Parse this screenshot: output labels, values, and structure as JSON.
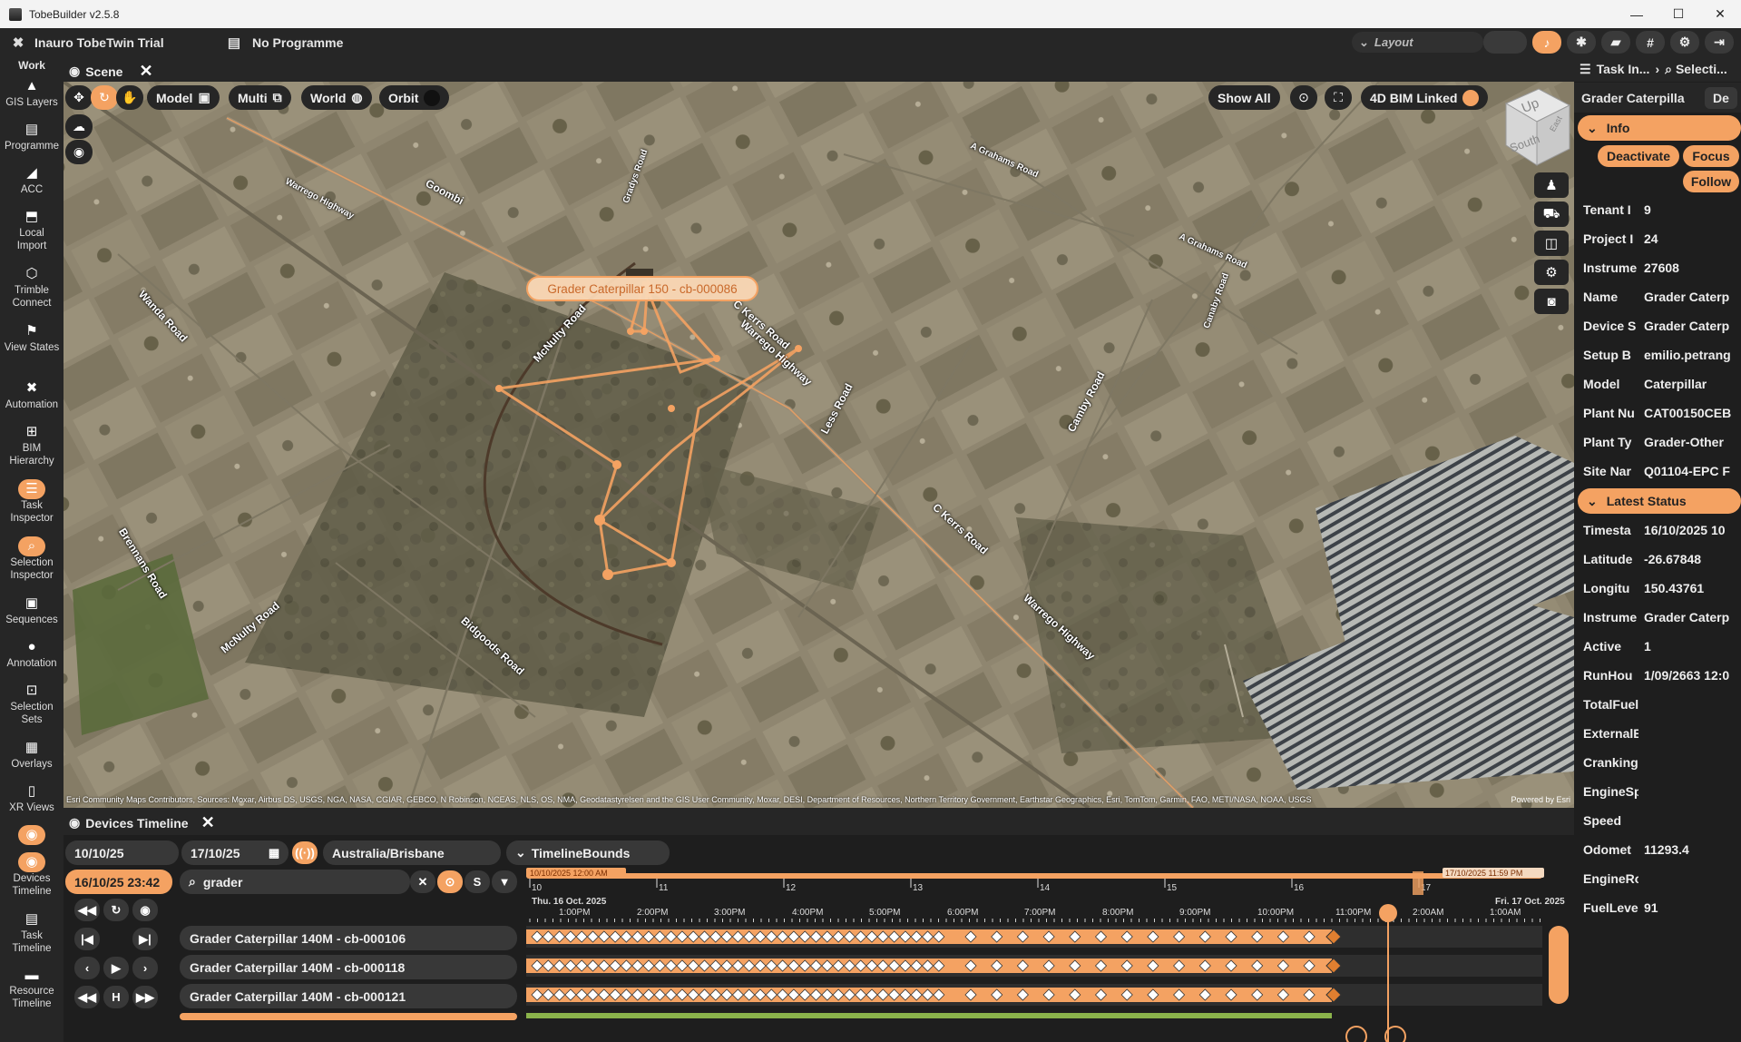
{
  "titlebar": {
    "title": "TobeBuilder v2.5.8",
    "minimize": "—",
    "maximize": "☐",
    "close": "✕"
  },
  "header": {
    "project": "Inauro TobeTwin Trial",
    "programme": "No Programme",
    "layout": "Layout"
  },
  "leftnav": {
    "work_label": "Work",
    "items": [
      {
        "label": "GIS Layers",
        "icon": "▲"
      },
      {
        "label": "Programme",
        "icon": "▤"
      },
      {
        "label": "ACC",
        "icon": "◢"
      },
      {
        "label": "Local Import",
        "icon": "⬒"
      },
      {
        "label": "Trimble Connect",
        "icon": "⬡"
      },
      {
        "label": "View States",
        "icon": "⚑"
      },
      {
        "label": "Automation",
        "icon": "✖"
      },
      {
        "label": "BIM Hierarchy",
        "icon": "⊞"
      },
      {
        "label": "Task Inspector",
        "icon": "☰"
      },
      {
        "label": "Selection Inspector",
        "icon": "⌕"
      },
      {
        "label": "Sequences",
        "icon": "▣"
      },
      {
        "label": "Annotation",
        "icon": "●"
      },
      {
        "label": "Selection Sets",
        "icon": "⊡"
      },
      {
        "label": "Overlays",
        "icon": "▦"
      },
      {
        "label": "XR Views",
        "icon": "▯"
      },
      {
        "label": "Devices Timeline",
        "icon": "◉"
      },
      {
        "label": "Task Timeline",
        "icon": "▤"
      },
      {
        "label": "Resource Timeline",
        "icon": "▬"
      }
    ]
  },
  "scene": {
    "tab_label": "Scene",
    "toolbar": {
      "model": "Model",
      "multi": "Multi",
      "world": "World",
      "orbit": "Orbit"
    },
    "right_toolbar": {
      "show_all": "Show All",
      "bim_linked": "4D BIM Linked"
    },
    "viewcube": {
      "up": "Up",
      "south": "South",
      "east": "East"
    },
    "device_label": "Grader  Caterpillar 150 - cb-000086",
    "roads": [
      "Goombi",
      "Wanda Road",
      "McNulty Road",
      "C Kerrs Road",
      "Warrego Highway",
      "Less Road",
      "Brennans Road",
      "McNulty Road",
      "Bidgoods Road",
      "C Kerrs Road",
      "Warrego Highway",
      "Camby Road",
      "Canaby Road",
      "A Grahams Road",
      "A Grahams Road",
      "Gradys Road",
      "Warrego Highway"
    ],
    "attribution": "Esri Community Maps Contributors, Sources: Moxar, Airbus DS, USGS, NGA, NASA, CGIAR, GEBCO, N Robinson, NCEAS, NLS, OS, NMA, Geodatastyrelsen and the GIS User Community, Moxar, DESI, Department of Resources, Northern Territory Government, Earthstar Geographics, Esri, TomTom, Garmin, FAO, METI/NASA, NOAA, USGS",
    "powered_by": "Powered by Esri"
  },
  "timeline": {
    "tab_label": "Devices Timeline",
    "start_date": "10/10/25",
    "end_date": "17/10/25",
    "timezone": "Australia/Brisbane",
    "bounds": "TimelineBounds",
    "current_time": "16/10/25 23:42",
    "search_value": "grader",
    "s_label": "S",
    "h_label": "H",
    "range_start_badge": "10/10/2025 12:00 AM",
    "range_end_badge": "17/10/2025 11:59 PM",
    "day_ticks": [
      "10",
      "11",
      "12",
      "13",
      "14",
      "15",
      "16",
      "17"
    ],
    "date_left": "Thu. 16 Oct. 2025",
    "date_right": "Fri. 17 Oct. 2025",
    "hour_ticks": [
      "1:00PM",
      "2:00PM",
      "3:00PM",
      "4:00PM",
      "5:00PM",
      "6:00PM",
      "7:00PM",
      "8:00PM",
      "9:00PM",
      "10:00PM",
      "11:00PM",
      "2:00AM",
      "1:00AM"
    ],
    "devices": [
      "Grader  Caterpillar 140M - cb-000106",
      "Grader  Caterpillar 140M - cb-000118",
      "Grader  Caterpillar 140M - cb-000121"
    ]
  },
  "rightpanel": {
    "tab_task": "Task In...",
    "tab_selection": "Selecti...",
    "title": "Grader  Caterpilla",
    "title_btn": "De",
    "info_label": "Info",
    "deactivate": "Deactivate",
    "focus": "Focus",
    "follow": "Follow",
    "info_rows": [
      {
        "k": "Tenant I",
        "v": "9"
      },
      {
        "k": "Project I",
        "v": "24"
      },
      {
        "k": "Instrume",
        "v": "27608"
      },
      {
        "k": "Name",
        "v": "Grader  Caterp"
      },
      {
        "k": "Device S",
        "v": "Grader  Caterp"
      },
      {
        "k": "Setup B",
        "v": "emilio.petrang"
      },
      {
        "k": "Model",
        "v": "Caterpillar"
      },
      {
        "k": "Plant Nu",
        "v": "CAT00150CEB"
      },
      {
        "k": "Plant Ty",
        "v": "Grader-Other"
      },
      {
        "k": "Site Nar",
        "v": "Q01104-EPC F"
      }
    ],
    "status_label": "Latest Status",
    "status_rows": [
      {
        "k": "Timesta",
        "v": "16/10/2025 10"
      },
      {
        "k": "Latitude",
        "v": "-26.67848"
      },
      {
        "k": "Longitu",
        "v": "150.43761"
      },
      {
        "k": "Instrume",
        "v": "Grader  Caterp"
      },
      {
        "k": "Active",
        "v": "1"
      },
      {
        "k": "RunHou",
        "v": "1/09/2663 12:0"
      },
      {
        "k": "TotalFuel",
        "v": ""
      },
      {
        "k": "ExternalB",
        "v": ""
      },
      {
        "k": "Cranking",
        "v": ""
      },
      {
        "k": "EngineSp",
        "v": ""
      },
      {
        "k": "Speed",
        "v": ""
      },
      {
        "k": "Odomet",
        "v": "11293.4"
      },
      {
        "k": "EngineRo",
        "v": ""
      },
      {
        "k": "FuelLeve",
        "v": "91"
      }
    ]
  },
  "colors": {
    "accent": "#f4a262",
    "panel": "#262626",
    "field": "#383838"
  }
}
